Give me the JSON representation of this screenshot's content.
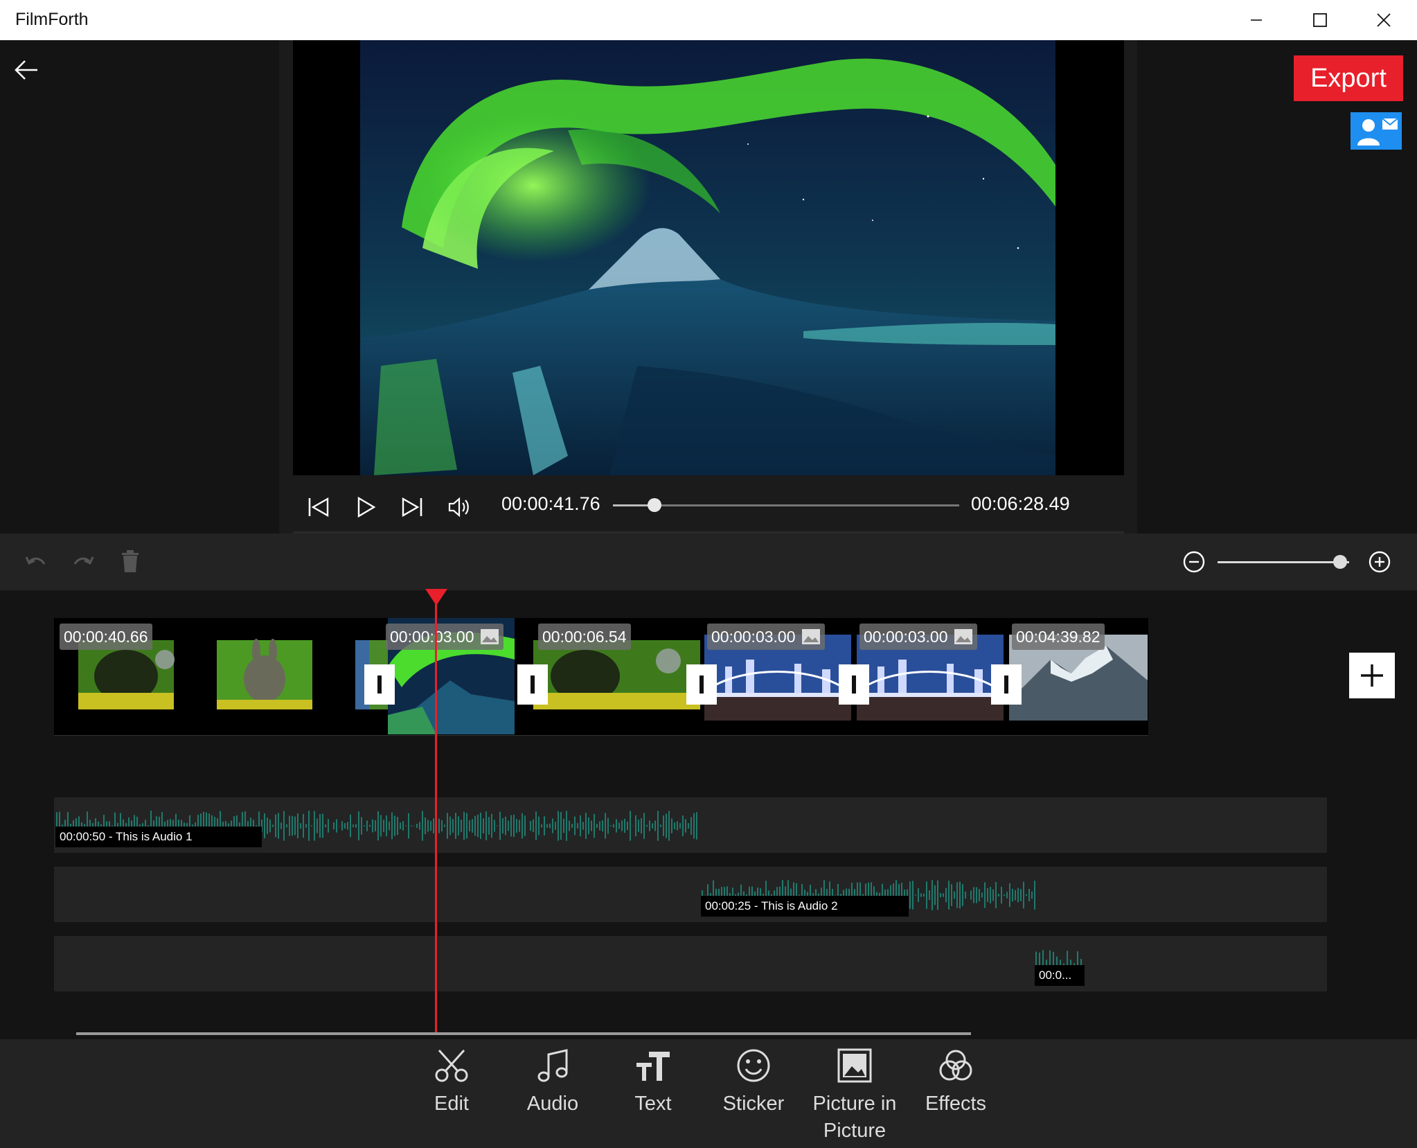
{
  "window": {
    "title": "FilmForth"
  },
  "player": {
    "current_time": "00:00:41.76",
    "total_time": "00:06:28.49",
    "progress": 0.12
  },
  "export_label": "Export",
  "zoom_level": 0.93,
  "clips": [
    {
      "duration": "00:00:40.66",
      "is_image": false
    },
    {
      "duration": "00:00:03.00",
      "is_image": true
    },
    {
      "duration": "00:00:06.54",
      "is_image": false
    },
    {
      "duration": "00:00:03.00",
      "is_image": true
    },
    {
      "duration": "00:00:03.00",
      "is_image": true
    },
    {
      "duration": "00:04:39.82",
      "is_image": false
    }
  ],
  "audio": [
    {
      "label": "00:00:50 -  This is Audio 1"
    },
    {
      "label": "00:00:25 - This is Audio 2"
    },
    {
      "label": "00:0..."
    }
  ],
  "tools": [
    {
      "label": "Edit",
      "icon": "scissors-icon"
    },
    {
      "label": "Audio",
      "icon": "music-note-icon"
    },
    {
      "label": "Text",
      "icon": "text-icon"
    },
    {
      "label": "Sticker",
      "icon": "smiley-icon"
    },
    {
      "label": "Picture in Picture",
      "icon": "picture-icon"
    },
    {
      "label": "Effects",
      "icon": "effects-icon"
    }
  ],
  "colors": {
    "accent": "#e8202b",
    "waveform": "#1f8f7e",
    "contact": "#1e8ff0"
  }
}
